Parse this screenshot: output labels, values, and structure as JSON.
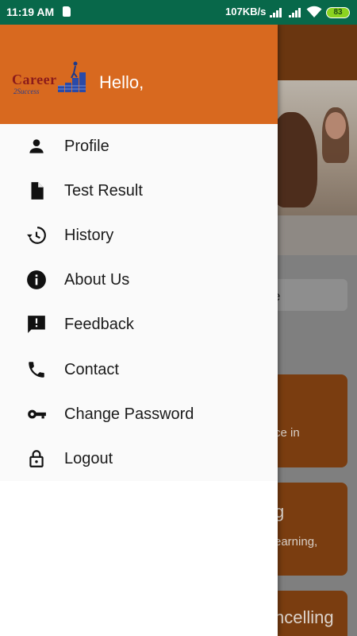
{
  "status_bar": {
    "time": "11:19 AM",
    "net_speed": "107KB/s",
    "battery": "83"
  },
  "drawer": {
    "greeting": "Hello,",
    "logo_text": "Career",
    "logo_subtext": "2Success",
    "items": [
      {
        "label": "Profile",
        "icon": "person-icon"
      },
      {
        "label": "Test Result",
        "icon": "document-icon"
      },
      {
        "label": "History",
        "icon": "history-icon"
      },
      {
        "label": "About Us",
        "icon": "info-icon"
      },
      {
        "label": "Feedback",
        "icon": "feedback-icon"
      },
      {
        "label": "Contact",
        "icon": "phone-icon"
      },
      {
        "label": "Change Password",
        "icon": "key-icon"
      },
      {
        "label": "Logout",
        "icon": "lock-icon"
      }
    ]
  },
  "background": {
    "search_text_fragment": "e",
    "card1_text": "ce in",
    "card2_title": "g",
    "card2_text": "earning,",
    "card3_title": "ncelling"
  },
  "colors": {
    "status_bar": "#08684a",
    "header": "#d8691f",
    "menu_bg": "#fafafa"
  }
}
